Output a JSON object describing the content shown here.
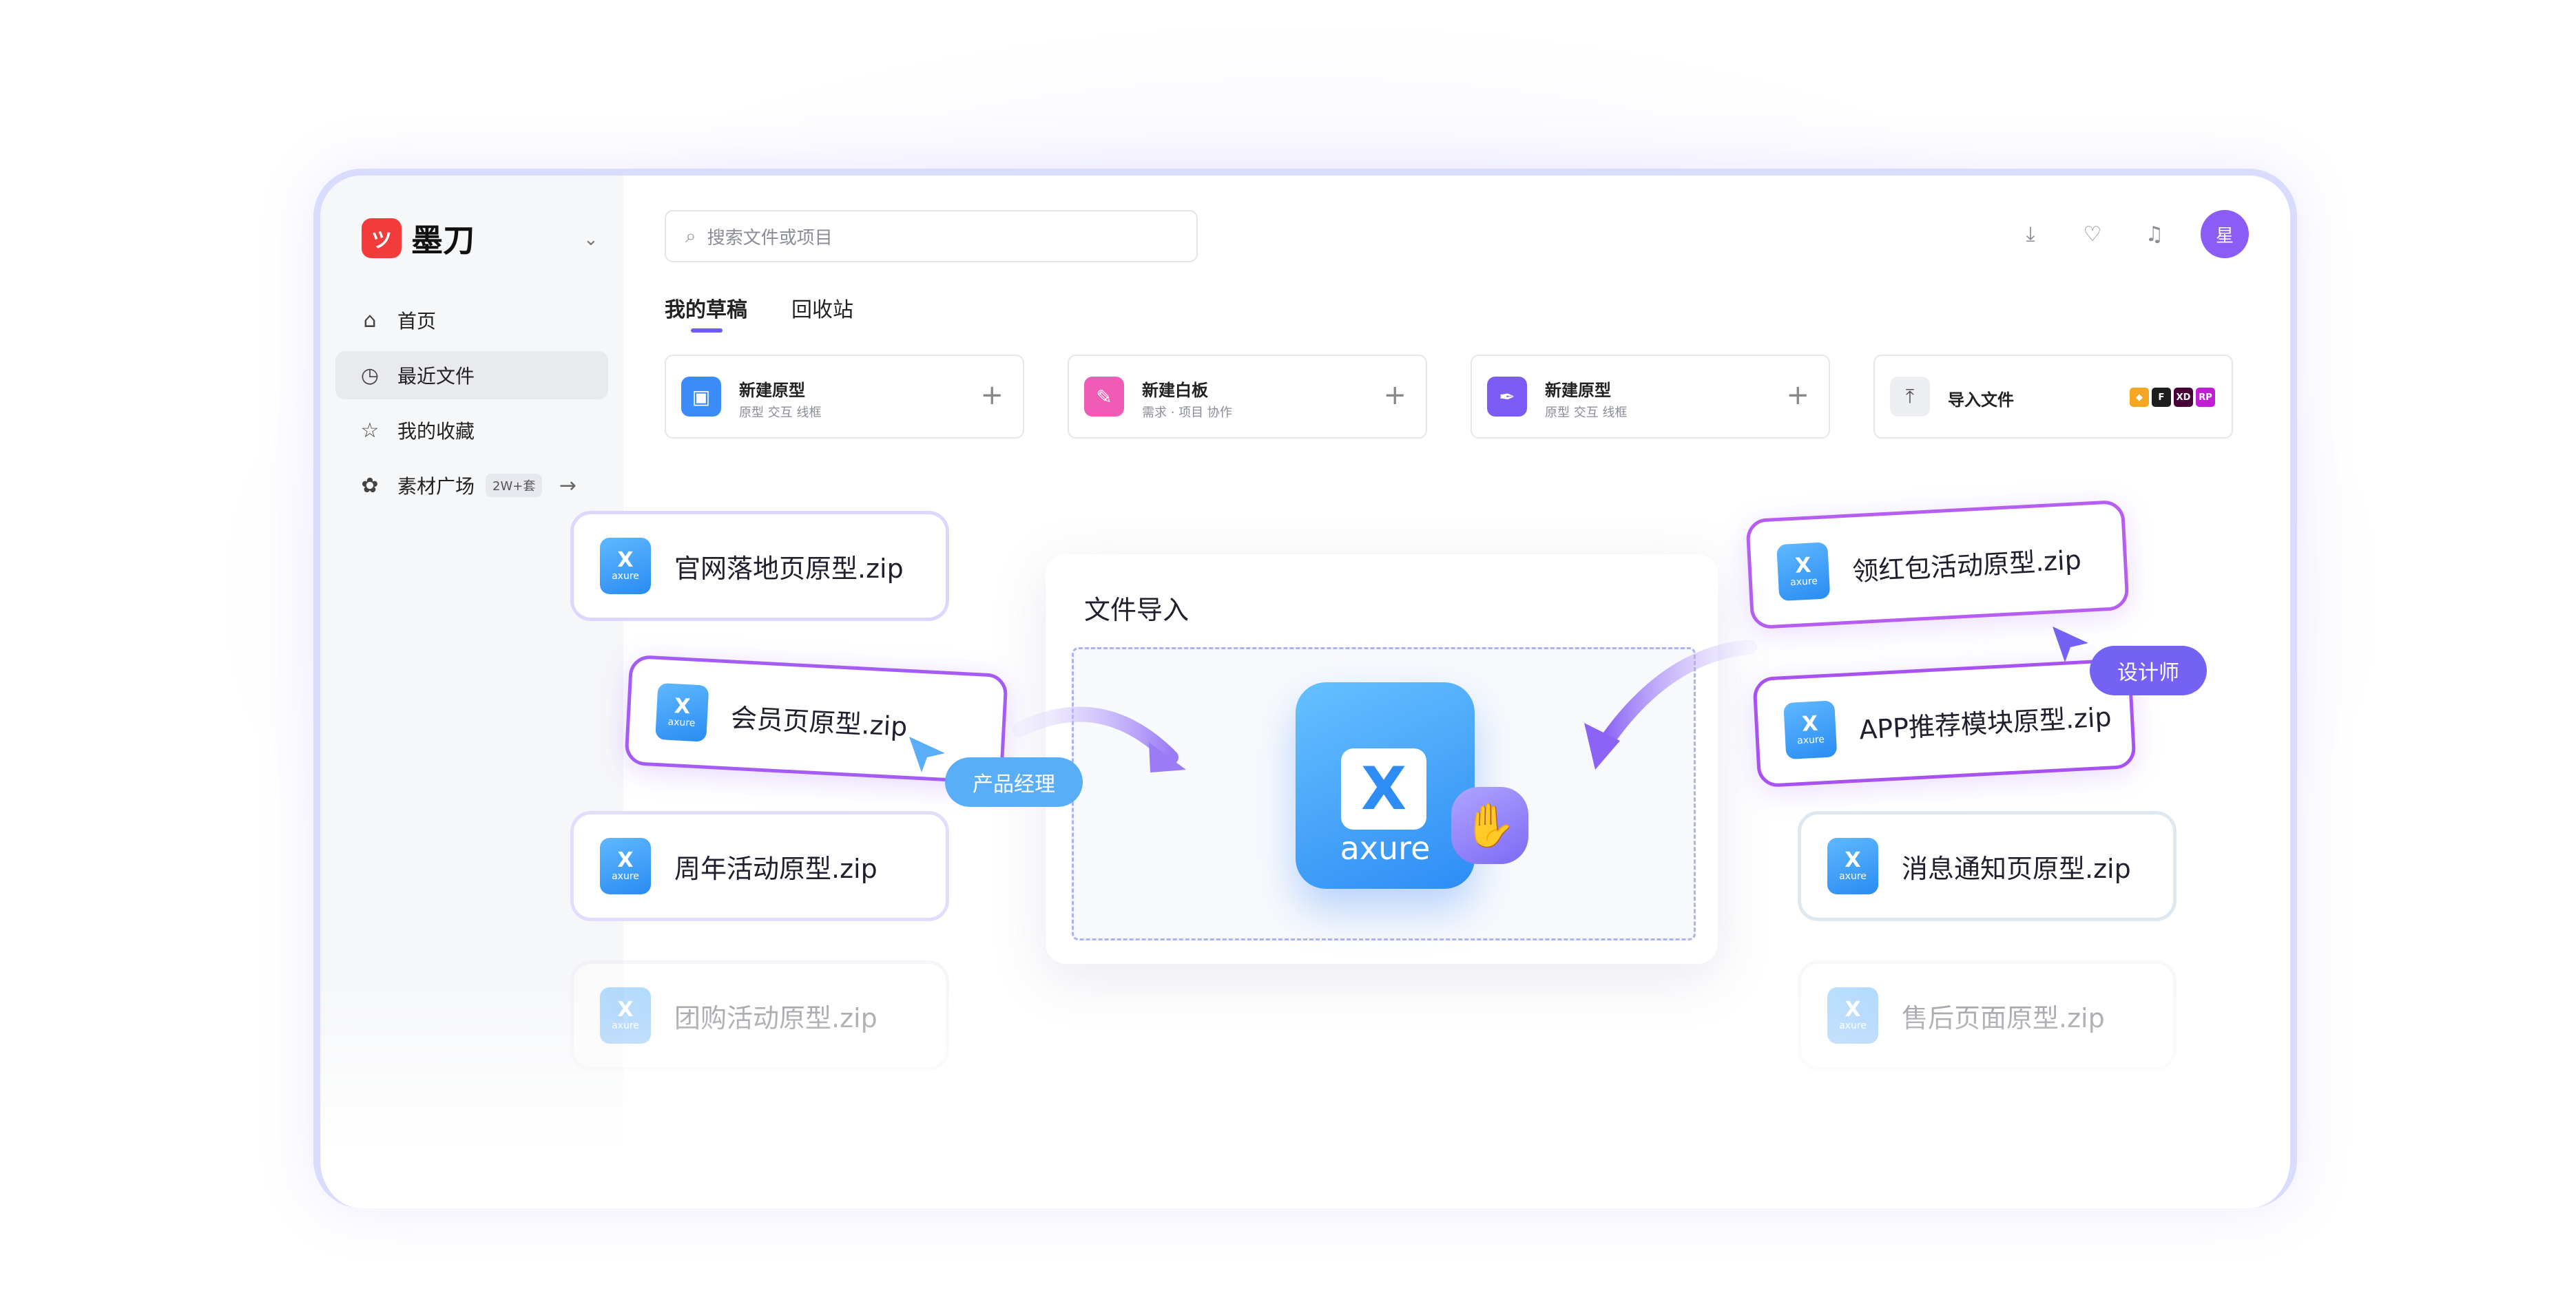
{
  "app": {
    "name": "墨刀",
    "logo_glyph": "ツ"
  },
  "search": {
    "placeholder": "搜索文件或项目"
  },
  "user": {
    "avatar_text": "星"
  },
  "sidebar": {
    "items": [
      {
        "label": "首页",
        "icon": "home-icon"
      },
      {
        "label": "最近文件",
        "icon": "clock-icon"
      },
      {
        "label": "我的收藏",
        "icon": "star-icon"
      },
      {
        "label": "素材广场",
        "icon": "assets-icon",
        "badge": "2W+套"
      }
    ]
  },
  "tabs": [
    "我的草稿",
    "回收站"
  ],
  "quick_actions": [
    {
      "title": "新建原型",
      "subtitle": "原型 交互 线框",
      "color": "#3b8cf6"
    },
    {
      "title": "新建白板",
      "subtitle": "需求 · 项目 协作",
      "color": "#f05bb5"
    },
    {
      "title": "新建原型",
      "subtitle": "原型 交互 线框",
      "color": "#7c5cf5"
    },
    {
      "title": "导入文件",
      "formats": [
        "sketch",
        "figma",
        "XD",
        "RP"
      ]
    }
  ],
  "import_panel": {
    "title": "文件导入",
    "icon_word": "axure",
    "icon_glyph": "X"
  },
  "files_left": [
    "官网落地页原型.zip",
    "会员页原型.zip",
    "周年活动原型.zip",
    "团购活动原型.zip"
  ],
  "files_right": [
    "领红包活动原型.zip",
    "APP推荐模块原型.zip",
    "消息通知页原型.zip",
    "售后页面原型.zip"
  ],
  "file_icon": {
    "glyph": "X",
    "word": "axure"
  },
  "roles": {
    "left": "产品经理",
    "right": "设计师"
  },
  "colors": {
    "accent": "#6b5cf6",
    "pill_blue": "#5aaef8",
    "pill_purple": "#7462f5"
  }
}
